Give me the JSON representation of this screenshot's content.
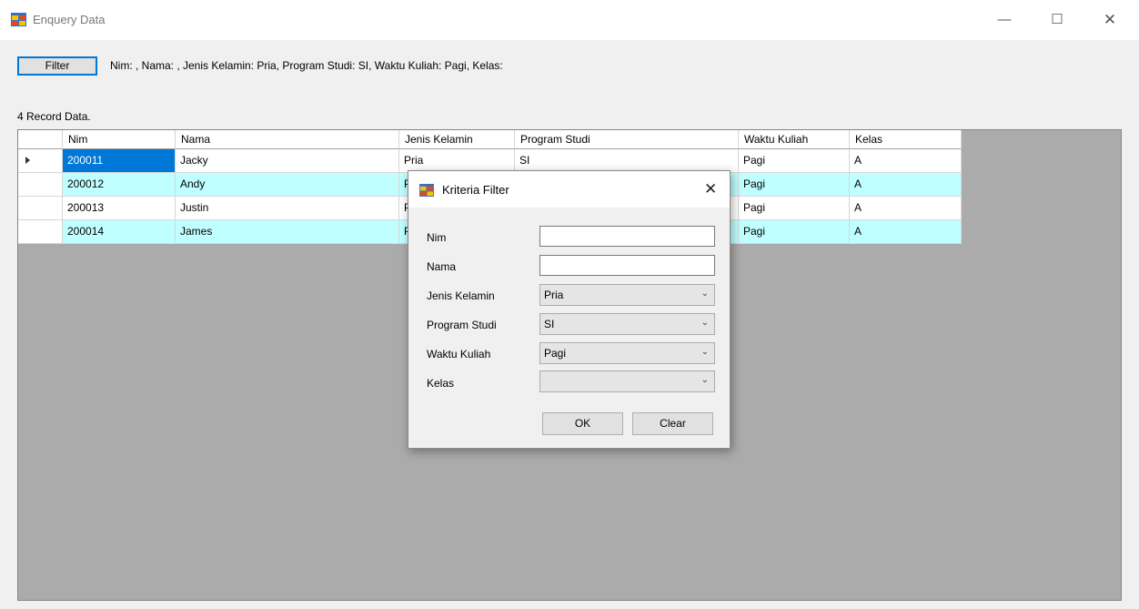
{
  "window": {
    "title": "Enquery Data",
    "controls": {
      "minimize": "—",
      "maximize": "☐",
      "close": "✕"
    }
  },
  "toolbar": {
    "filter_label": "Filter",
    "filter_info": "Nim: , Nama: , Jenis Kelamin: Pria, Program Studi: SI, Waktu Kuliah: Pagi, Kelas:"
  },
  "record_count": "4 Record Data.",
  "grid": {
    "columns": [
      "Nim",
      "Nama",
      "Jenis Kelamin",
      "Program Studi",
      "Waktu Kuliah",
      "Kelas"
    ],
    "rows": [
      [
        "200011",
        "Jacky",
        "Pria",
        "SI",
        "Pagi",
        "A"
      ],
      [
        "200012",
        "Andy",
        "P",
        "",
        "Pagi",
        "A"
      ],
      [
        "200013",
        "Justin",
        "P",
        "",
        "Pagi",
        "A"
      ],
      [
        "200014",
        "James",
        "P",
        "",
        "Pagi",
        "A"
      ]
    ],
    "row_colors": [
      "#ffffff",
      "#c0ffff",
      "#ffffff",
      "#c0ffff"
    ],
    "selected_color": "#0078d7"
  },
  "dialog": {
    "title": "Kriteria Filter",
    "close": "✕",
    "fields": {
      "nim": {
        "label": "Nim",
        "value": ""
      },
      "nama": {
        "label": "Nama",
        "value": ""
      },
      "jenis_kelamin": {
        "label": "Jenis Kelamin",
        "value": "Pria"
      },
      "program_studi": {
        "label": "Program Studi",
        "value": "SI"
      },
      "waktu_kuliah": {
        "label": "Waktu Kuliah",
        "value": "Pagi"
      },
      "kelas": {
        "label": "Kelas",
        "value": ""
      }
    },
    "ok_label": "OK",
    "clear_label": "Clear"
  }
}
